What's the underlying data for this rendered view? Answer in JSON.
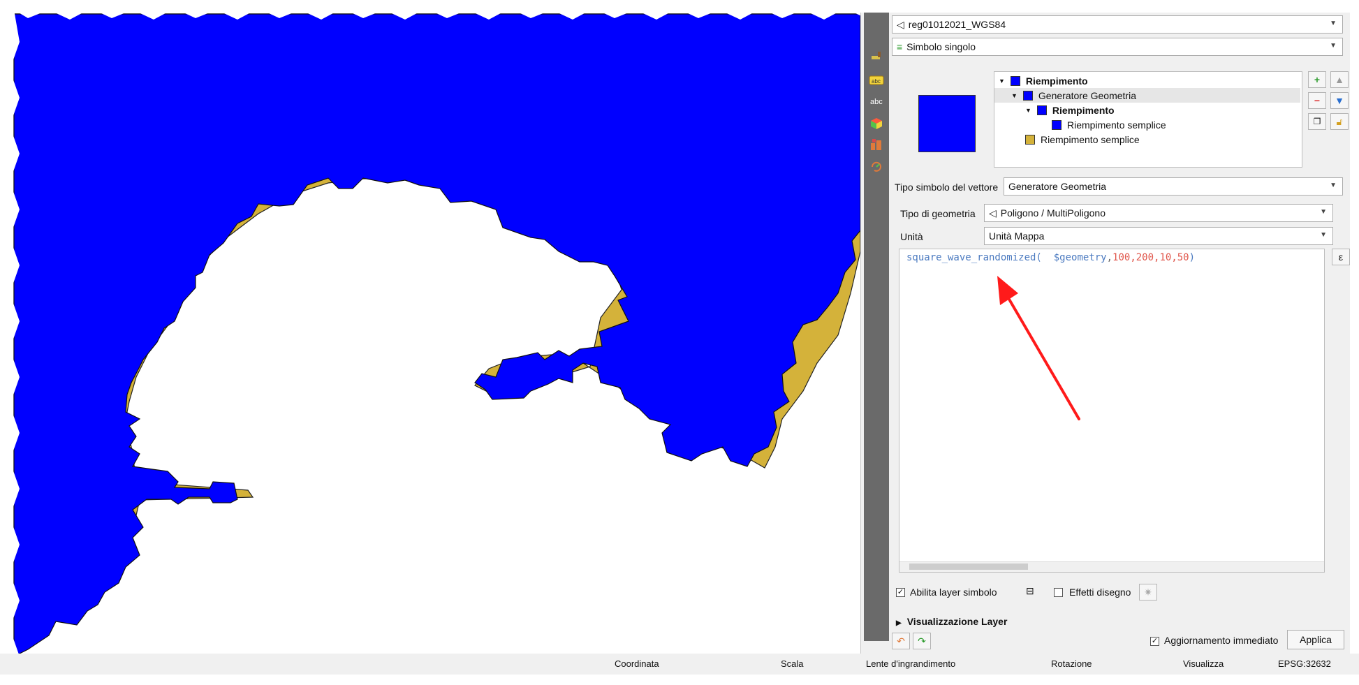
{
  "layer_panel": {
    "layer_combo_value": "reg01012021_WGS84",
    "renderer_combo_value": "Simbolo singolo",
    "symbol_tree": [
      {
        "label": "Riempimento",
        "bold": true,
        "color": "#0000ff"
      },
      {
        "label": "Generatore Geometria",
        "bold": false,
        "color": "#0000ff"
      },
      {
        "label": "Riempimento",
        "bold": true,
        "color": "#0000ff"
      },
      {
        "label": "Riempimento semplice",
        "bold": false,
        "color": "#0000ff"
      },
      {
        "label": "Riempimento semplice",
        "bold": false,
        "color": "#d4b23a"
      }
    ],
    "symbol_layer_type_label": "Tipo simbolo del vettore",
    "symbol_layer_type_value": "Generatore Geometria",
    "geometry_type_label": "Tipo di geometria",
    "geometry_type_value": "Poligono / MultiPoligono",
    "unit_label": "Unità",
    "unit_value": "Unità Mappa",
    "expression": {
      "func": "square_wave_randomized(",
      "arg_var": "  $geometry",
      "arg_nums": "100,200,10,50",
      "close": ")"
    },
    "enable_layer_label": "Abilita layer simbolo",
    "draw_effects_label": "Effetti disegno",
    "layer_rendering_label": "Visualizzazione Layer",
    "live_update_label": "Aggiornamento immediato",
    "apply_label": "Applica",
    "expression_button_label": "ε"
  },
  "status_bar": {
    "coordinate_label": "Coordinata",
    "scale_label": "Scala",
    "rotation_label": "Rotazione",
    "magnifier_label": "Lente d'ingrandimento",
    "render_label": "Visualizza",
    "epsg_label": "EPSG:32632"
  },
  "colors": {
    "fill_blue": "#0000ff",
    "outline_gold": "#d4b23a",
    "arrow_red": "#ff1a1a"
  }
}
